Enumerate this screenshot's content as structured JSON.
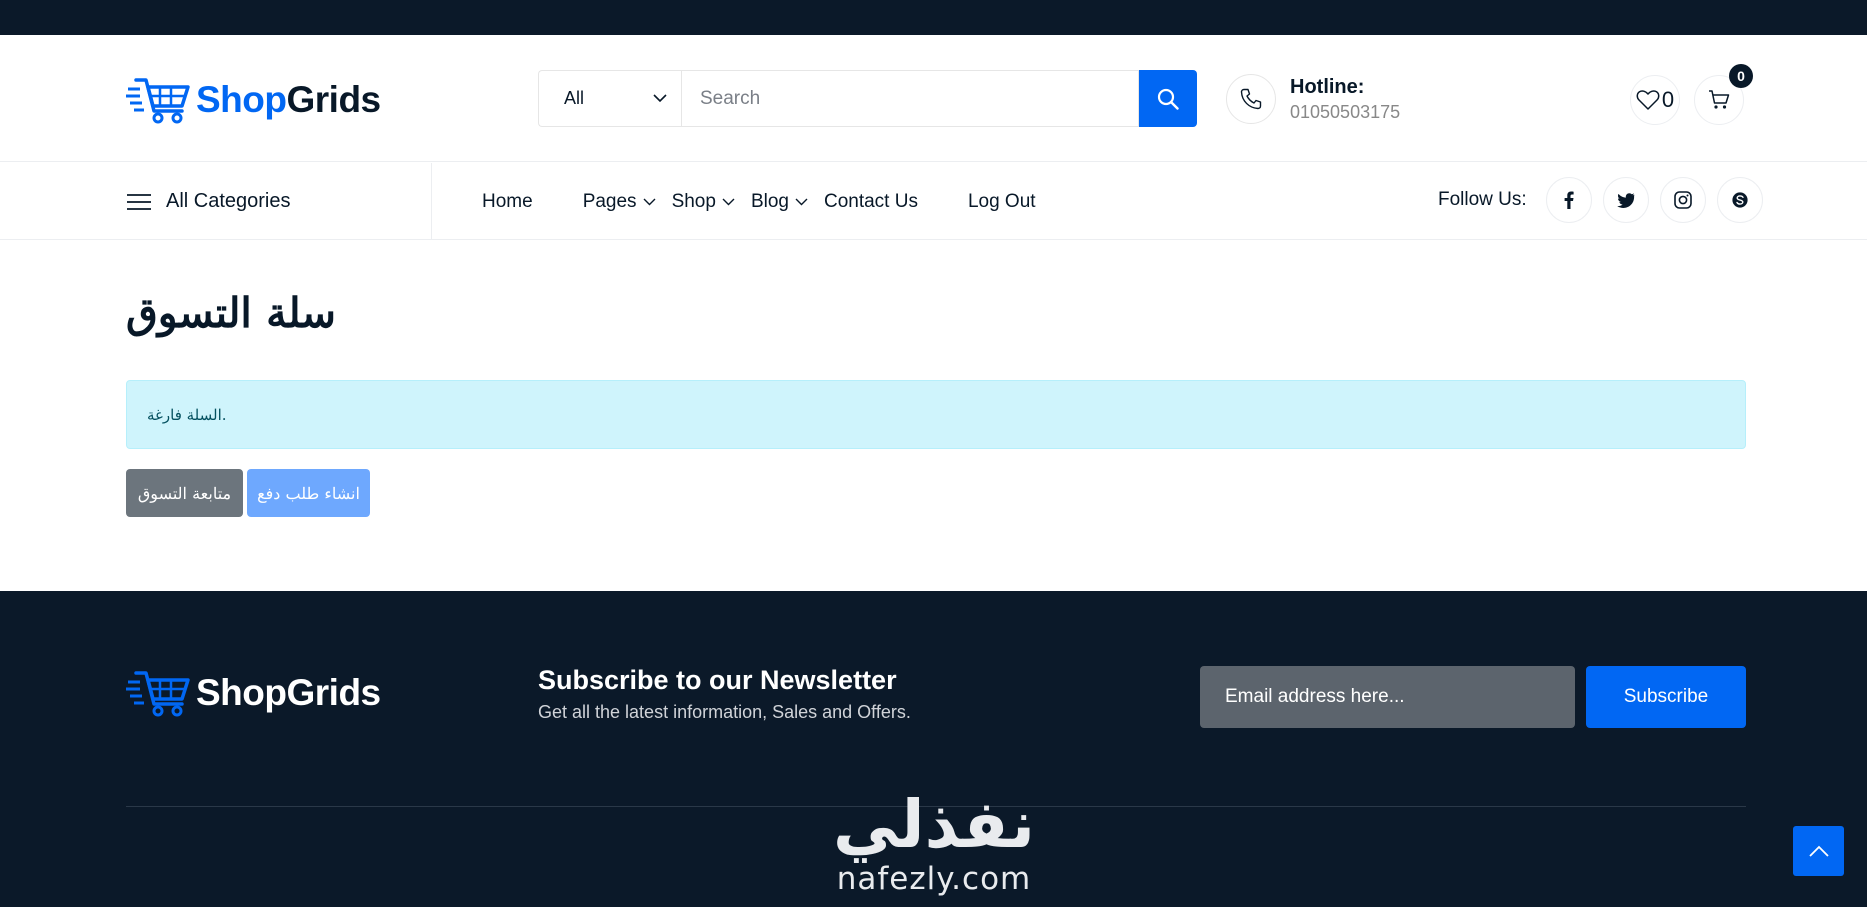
{
  "brand": {
    "name_part1": "Shop",
    "name_part2": "Grids",
    "footer_name": "ShopGrids"
  },
  "search": {
    "category_selected": "All",
    "placeholder": "Search"
  },
  "hotline": {
    "title": "Hotline:",
    "number": "01050503175"
  },
  "wishlist": {
    "count": "0"
  },
  "cart": {
    "count": "0"
  },
  "nav": {
    "all_categories": "All Categories",
    "items": [
      {
        "label": "Home"
      },
      {
        "label": "Pages"
      },
      {
        "label": "Shop"
      },
      {
        "label": "Blog"
      },
      {
        "label": "Contact Us"
      },
      {
        "label": "Log Out"
      }
    ],
    "follow_label": "Follow Us:",
    "social": [
      "facebook-icon",
      "twitter-icon",
      "instagram-icon",
      "skype-icon"
    ]
  },
  "main": {
    "title": "سلة التسوق",
    "alert": "السلة فارغة.",
    "continue_btn": "متابعة التسوق",
    "checkout_btn": "انشاء طلب دفع"
  },
  "footer": {
    "newsletter_title": "Subscribe to our Newsletter",
    "newsletter_sub": "Get all the latest information, Sales and Offers.",
    "email_placeholder": "Email address here...",
    "subscribe_label": "Subscribe"
  },
  "watermark": {
    "ar": "نفذلي",
    "en": "nafezly.com"
  },
  "colors": {
    "primary": "#0167f3",
    "dark": "#081828",
    "footer_bg": "#0b1929",
    "alert_bg": "#cff4fc"
  }
}
